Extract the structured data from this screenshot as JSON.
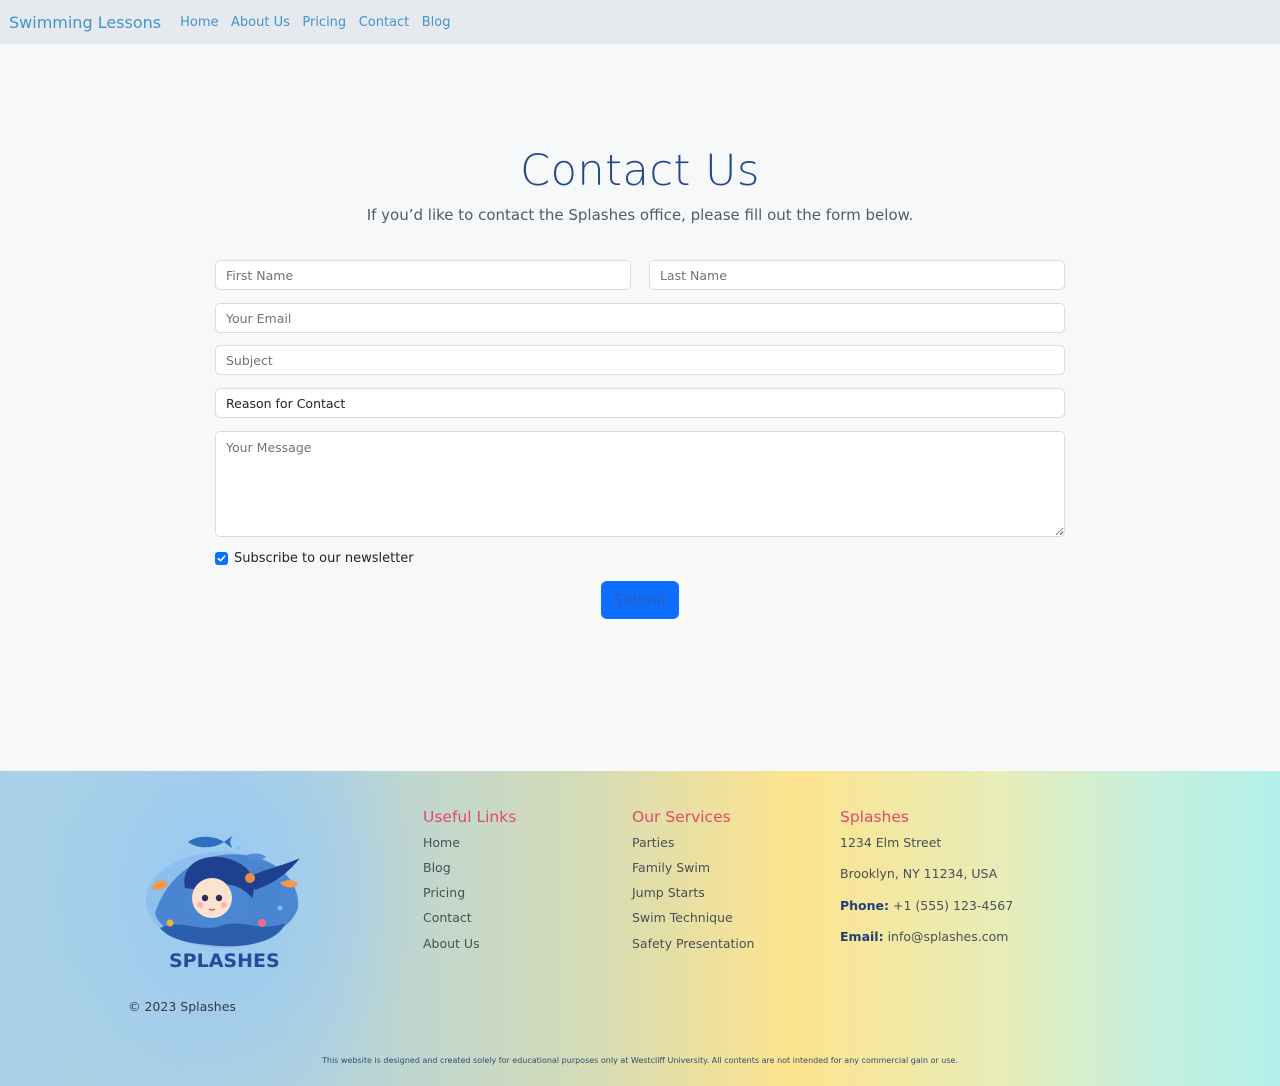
{
  "nav": {
    "brand": "Swimming Lessons",
    "links": [
      "Home",
      "About Us",
      "Pricing",
      "Contact",
      "Blog"
    ]
  },
  "main": {
    "title": "Contact Us",
    "subtitle": "If you’d like to contact the Splashes office, please fill out the form below.",
    "form": {
      "first_name_placeholder": "First Name",
      "last_name_placeholder": "Last Name",
      "email_placeholder": "Your Email",
      "subject_placeholder": "Subject",
      "reason_selected": "Reason for Contact",
      "message_placeholder": "Your Message",
      "newsletter_label": "Subscribe to our newsletter",
      "newsletter_checked": true,
      "submit_label": "Submit"
    }
  },
  "footer": {
    "logo_text": "SPLASHES",
    "copyright": "© 2023 Splashes",
    "useful_links": {
      "heading": "Useful Links",
      "items": [
        "Home",
        "Blog",
        "Pricing",
        "Contact",
        "About Us"
      ]
    },
    "services": {
      "heading": "Our Services",
      "items": [
        "Parties",
        "Family Swim",
        "Jump Starts",
        "Swim Technique",
        "Safety Presentation"
      ]
    },
    "contact": {
      "heading": "Splashes",
      "address_line1": "1234 Elm Street",
      "address_line2": "Brooklyn, NY 11234, USA",
      "phone_label": "Phone:",
      "phone": "+1 (555) 123-4567",
      "email_label": "Email:",
      "email": "info@splashes.com"
    },
    "disclaimer": "This website is designed and created solely for educational purposes only at Westcliff University. All contents are not intended for any commercial gain or use."
  },
  "colors": {
    "accent": "#0d6efd",
    "title": "#21498a",
    "footer_heading": "#e14a6a",
    "nav_link": "#3f95d1"
  }
}
